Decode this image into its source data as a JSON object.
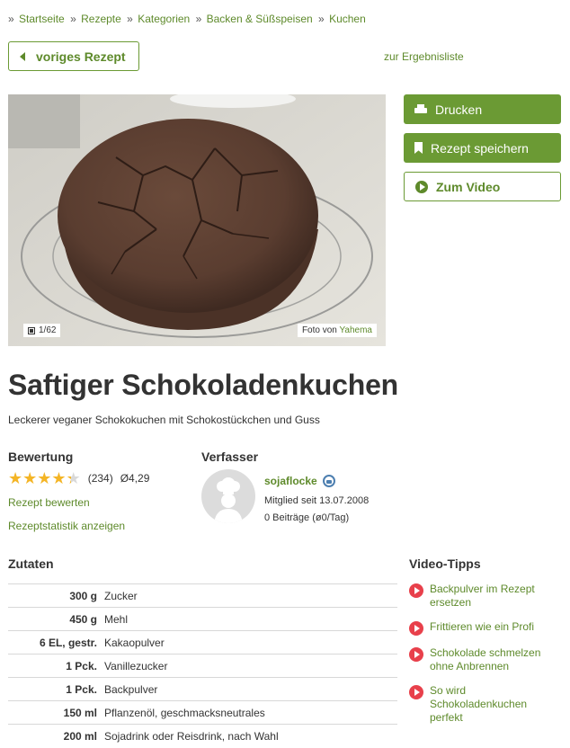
{
  "breadcrumb": {
    "separator": "»",
    "items": [
      "Startseite",
      "Rezepte",
      "Kategorien",
      "Backen & Süßspeisen",
      "Kuchen"
    ]
  },
  "nav": {
    "prev_label": "voriges Rezept",
    "results_label": "zur Ergebnisliste"
  },
  "photo": {
    "counter": "1/62",
    "credit_prefix": "Foto von",
    "credit_author": "Yahema"
  },
  "actions": {
    "print": "Drucken",
    "save": "Rezept speichern",
    "video": "Zum Video"
  },
  "recipe": {
    "title": "Saftiger Schokoladenkuchen",
    "subtitle": "Leckerer veganer Schokokuchen mit Schokostückchen und Guss"
  },
  "rating": {
    "heading": "Bewertung",
    "stars_value": 4.29,
    "count": "(234)",
    "average": "Ø4,29",
    "rate_link": "Rezept bewerten",
    "stats_link": "Rezeptstatistik anzeigen"
  },
  "author": {
    "heading": "Verfasser",
    "name": "sojaflocke",
    "member_since": "Mitglied seit 13.07.2008",
    "posts": "0 Beiträge (ø0/Tag)",
    "badge_icon": "chef-hat-badge-icon"
  },
  "ingredients": {
    "heading": "Zutaten",
    "rows": [
      {
        "amount": "300 g",
        "name": "Zucker"
      },
      {
        "amount": "450 g",
        "name": "Mehl"
      },
      {
        "amount": "6 EL, gestr.",
        "name": "Kakaopulver"
      },
      {
        "amount": "1 Pck.",
        "name": "Vanillezucker"
      },
      {
        "amount": "1 Pck.",
        "name": "Backpulver"
      },
      {
        "amount": "150 ml",
        "name": "Pflanzenöl, geschmacksneutrales"
      },
      {
        "amount": "200 ml",
        "name": "Sojadrink oder Reisdrink, nach Wahl"
      }
    ]
  },
  "video_tips": {
    "heading": "Video-Tipps",
    "items": [
      "Backpulver im Rezept ersetzen",
      "Frittieren wie ein Profi",
      "Schokolade schmelzen ohne Anbrennen",
      "So wird Schokoladenkuchen perfekt"
    ]
  },
  "colors": {
    "brand_green": "#6b9a34",
    "link_green": "#5e8a2b",
    "star": "#f4b526",
    "video_red": "#e8404b"
  }
}
